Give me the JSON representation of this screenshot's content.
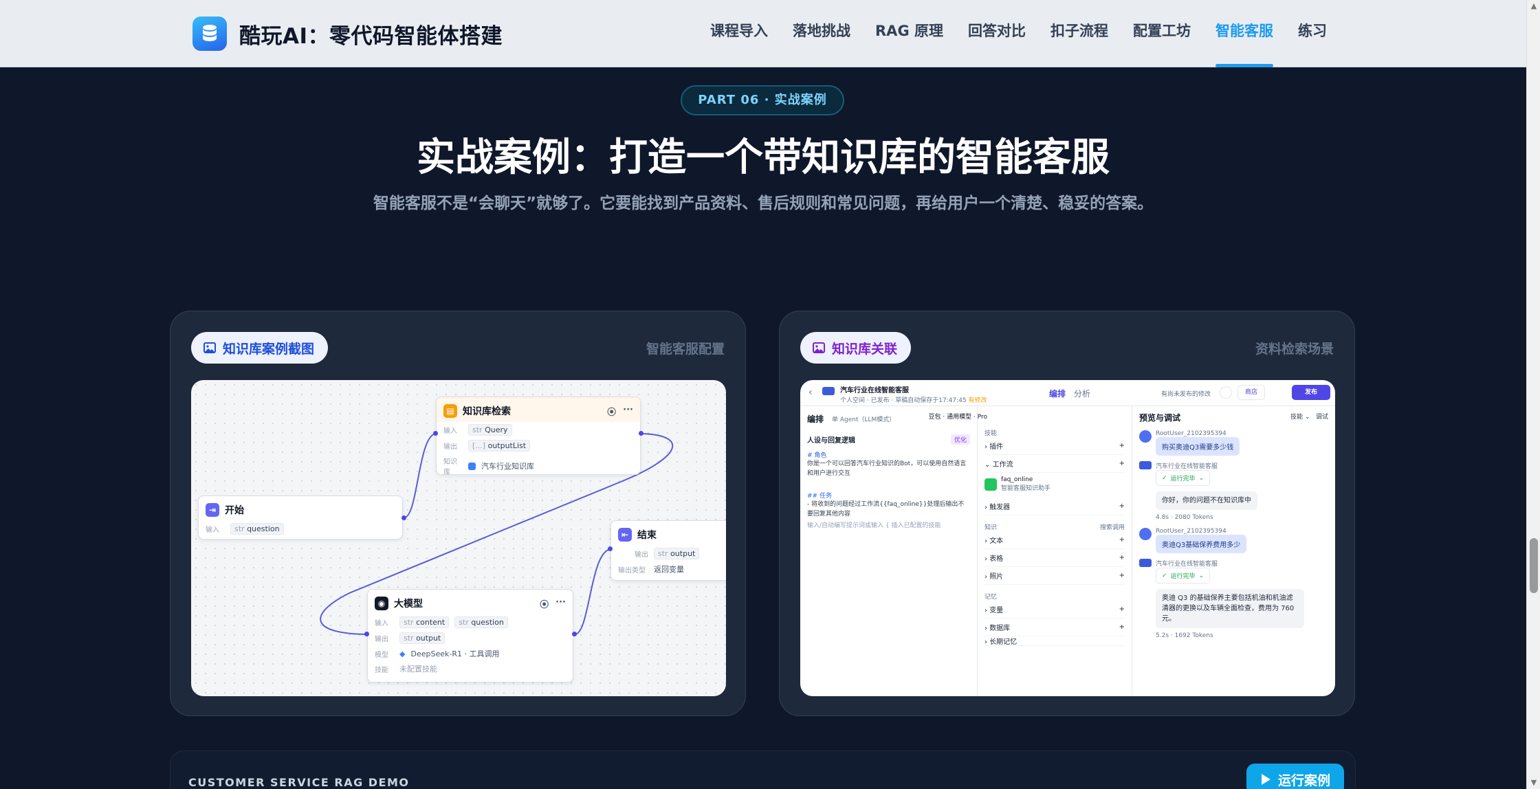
{
  "nav": {
    "brand": "酷玩AI：零代码智能体搭建",
    "items": [
      {
        "label": "课程导入"
      },
      {
        "label": "落地挑战"
      },
      {
        "label": "RAG 原理"
      },
      {
        "label": "回答对比"
      },
      {
        "label": "扣子流程"
      },
      {
        "label": "配置工坊"
      },
      {
        "label": "智能客服",
        "active": true
      },
      {
        "label": "练习"
      }
    ]
  },
  "hero": {
    "pill": "PART 06 · 实战案例",
    "title": "实战案例：打造一个带知识库的智能客服",
    "subtitle": "智能客服不是“会聊天”就够了。它要能找到产品资料、售后规则和常见问题，再给用户一个清楚、稳妥的答案。"
  },
  "cards": [
    {
      "tag": "知识库案例截图",
      "meta": "智能客服配置",
      "workflow": {
        "kb_node": {
          "title": "知识库检索",
          "in_label": "输入",
          "in_type": "str",
          "in_value": "Query",
          "out_label": "输出",
          "out_type": "[...]",
          "out_value": "outputList",
          "kb_label": "知识库",
          "kb_value": "汽车行业知识库"
        },
        "start_node": {
          "title": "开始",
          "in_label": "输入",
          "in_type": "str",
          "in_value": "question"
        },
        "end_node": {
          "title": "结束",
          "out_label": "输出",
          "out_type": "str",
          "out_value": "output",
          "type_label": "输出类型",
          "type_value": "返回变量"
        },
        "llm_node": {
          "title": "大模型",
          "in_label": "输入",
          "in1_type": "str",
          "in1_value": "content",
          "in2_type": "str",
          "in2_value": "question",
          "out_label": "输出",
          "out_type": "str",
          "out_value": "output",
          "model_label": "模型",
          "model_value": "DeepSeek-R1 · 工具调用",
          "skill_label": "技能",
          "skill_value": "未配置技能"
        }
      }
    },
    {
      "tag": "知识库关联",
      "meta": "资料检索场景",
      "agent": {
        "bot_name": "汽车行业在线智能客服",
        "bot_sub": "个人空间",
        "published": "已发布",
        "saved": "草稿自动保存于17:47:45",
        "flag": "有修改",
        "tab_edit": "编排",
        "tab_analyze": "分析",
        "unpublished_note": "有尚未发布的修改",
        "store_btn": "商店",
        "publish_btn": "发布",
        "left_title": "编排",
        "agent_mode": "单 Agent（LLM模式）",
        "model": "豆包 · 通用模型 · Pro",
        "persona_title": "人设与回复逻辑",
        "optimize": "优化",
        "role_heading": "# 角色",
        "role_text": "你是一个可以回答汽车行业知识的Bot，可以使用自然语言和用户进行交互",
        "task_heading": "## 任务",
        "task_text": "- 将收到的问题经过工作流{{faq_online}}处理后输出不要回复其他内容",
        "input_hint": "输入/自动编写提示词或输入 { 插入已配置的技能",
        "skills": "技能",
        "plugin": "插件",
        "workflow": "工作流",
        "wf_name": "faq_online",
        "wf_desc": "智能客服知识助手",
        "trigger": "触发器",
        "knowledge": "知识",
        "search_mode": "搜索调用",
        "text": "文本",
        "table": "表格",
        "photo": "照片",
        "memory": "记忆",
        "variable": "变量",
        "database": "数据库",
        "long_mem": "长期记忆",
        "preview_title": "预览与调试",
        "skill_btn": "技能",
        "debug_btn": "调试",
        "user_name": "RootUser_2102395394",
        "bot_label": "汽车行业在线智能客服",
        "q1": "购买奥迪Q3需要多少钱",
        "running1": "运行完毕",
        "a1": "你好，你的问题不在知识库中",
        "stats1": "4.8s · 2080 Tokens",
        "q2": "奥迪Q3基础保养费用多少",
        "running2": "运行完毕",
        "a2": "奥迪 Q3 的基础保养主要包括机油和机油滤清器的更换以及车辆全面检查，费用为 760 元。",
        "stats2": "5.2s · 1692 Tokens"
      }
    }
  ],
  "bottom": {
    "label": "CUSTOMER SERVICE RAG DEMO",
    "run_btn": "运行案例"
  },
  "colors": {
    "accent": "#1d9bf0",
    "background": "#0f172a",
    "card": "#1e293b"
  }
}
